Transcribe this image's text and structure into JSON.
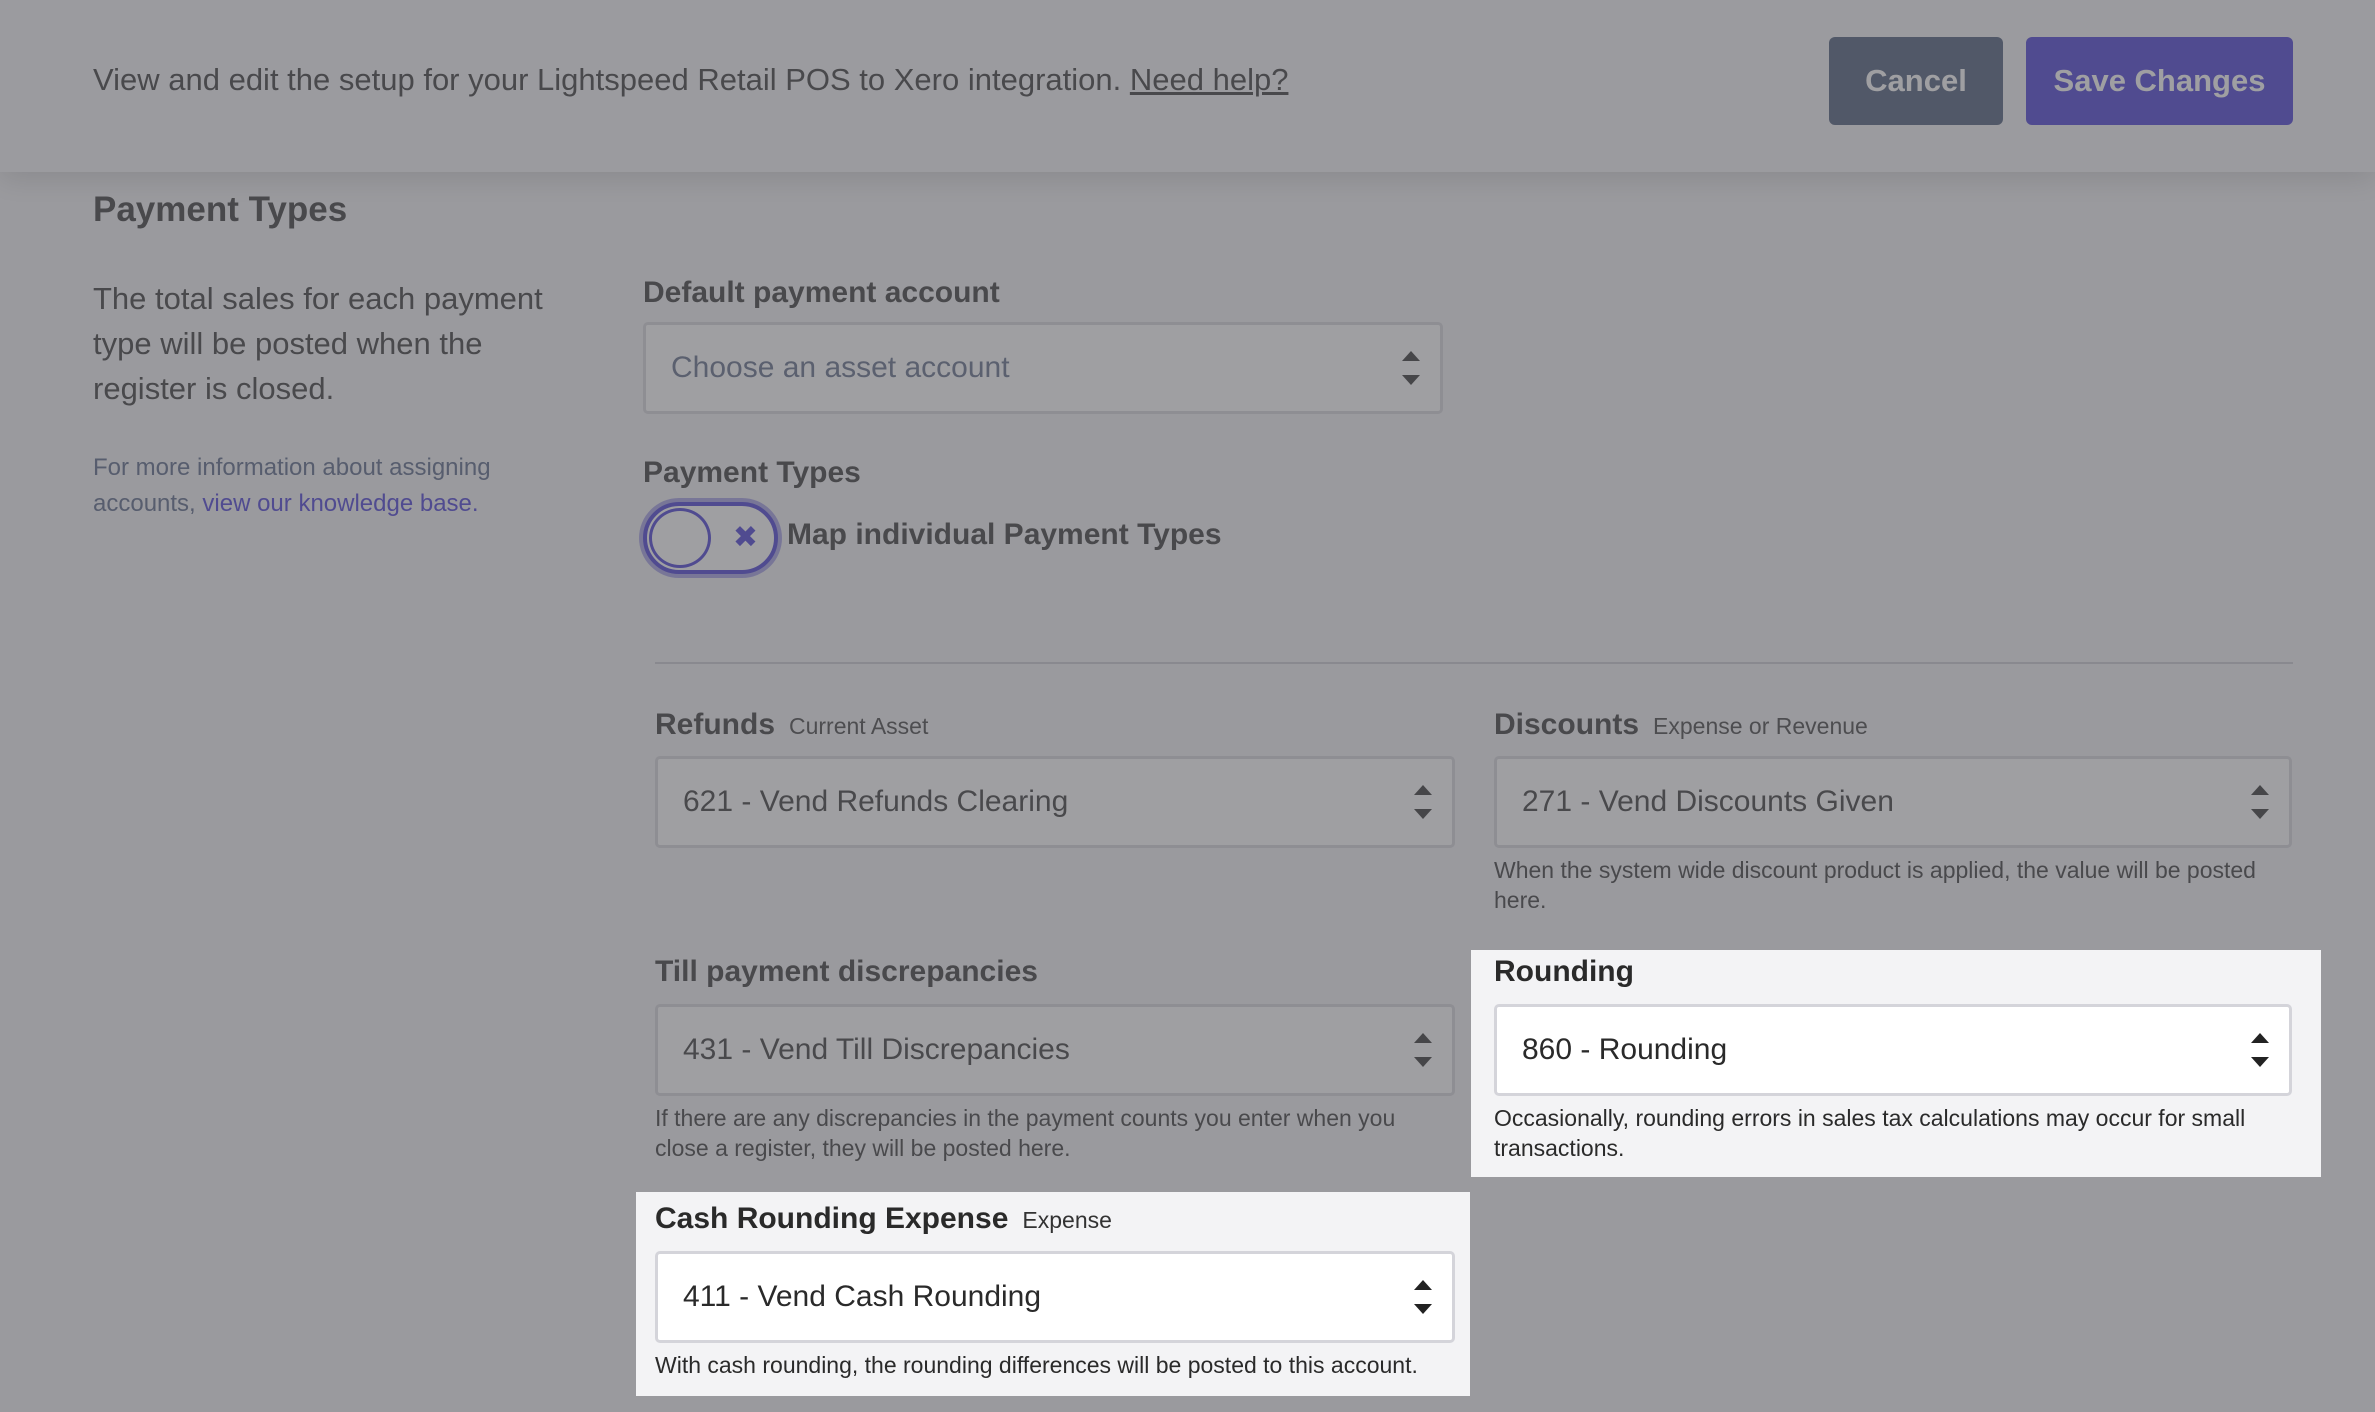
{
  "header": {
    "intro_text": "View and edit the setup for your Lightspeed Retail POS to Xero integration.",
    "help_link": "Need help?",
    "cancel_label": "Cancel",
    "save_label": "Save Changes"
  },
  "section": {
    "title": "Payment Types",
    "description": "The total sales for each payment type will be posted when the register is closed.",
    "kb_prefix": "For more information about assigning accounts,",
    "kb_link": "view our knowledge base."
  },
  "default_payment": {
    "label": "Default payment account",
    "placeholder": "Choose an asset account"
  },
  "payment_types": {
    "label": "Payment Types",
    "toggle_label": "Map individual Payment Types",
    "toggle_icon": "✖",
    "toggle_on": false
  },
  "fields": {
    "refunds": {
      "label": "Refunds",
      "sublabel": "Current Asset",
      "value": "621 - Vend Refunds Clearing"
    },
    "discounts": {
      "label": "Discounts",
      "sublabel": "Expense or Revenue",
      "value": "271 - Vend Discounts Given",
      "help": "When the system wide discount product is applied, the value will be posted here."
    },
    "till": {
      "label": "Till payment discrepancies",
      "value": "431 - Vend Till Discrepancies",
      "help": "If there are any discrepancies in the payment counts you enter when you close a register, they will be posted here."
    },
    "rounding": {
      "label": "Rounding",
      "value": "860 - Rounding",
      "help": "Occasionally, rounding errors in sales tax calculations may occur for small transactions."
    },
    "cash_rounding": {
      "label": "Cash Rounding Expense",
      "sublabel": "Expense",
      "value": "411 - Vend Cash Rounding",
      "help": "With cash rounding, the rounding differences will be posted to this account."
    }
  }
}
